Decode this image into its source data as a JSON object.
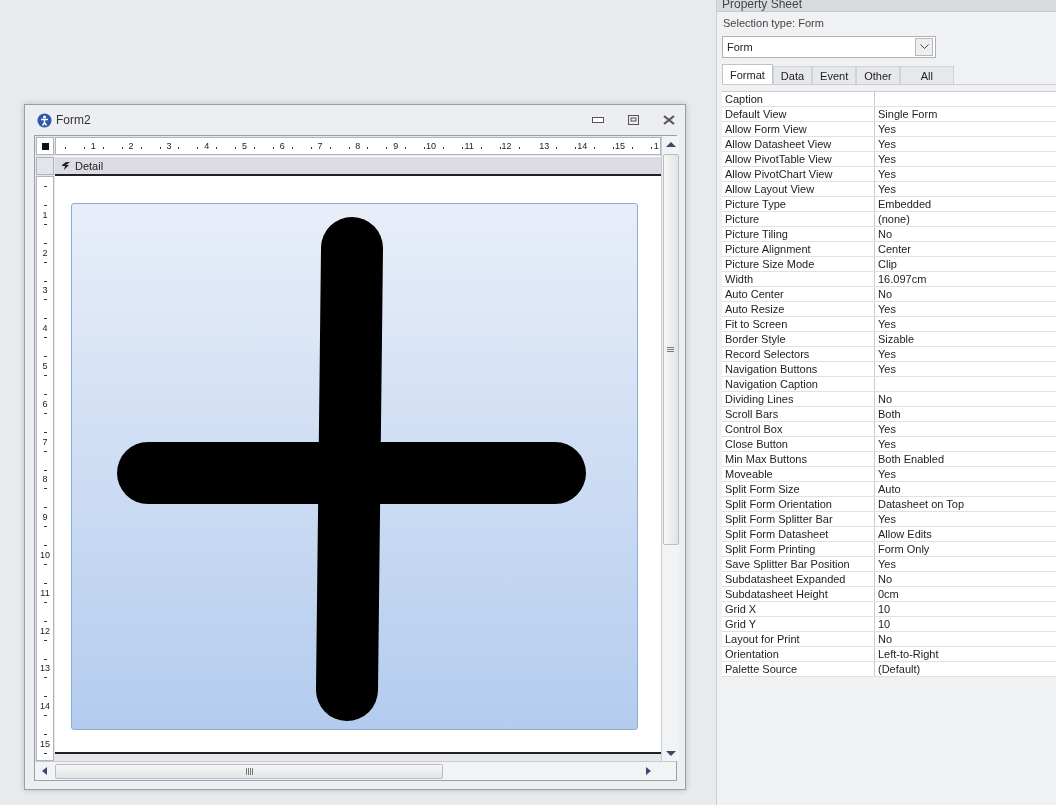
{
  "form_window": {
    "title": "Form2",
    "top_ruler": [
      "1",
      "2",
      "3",
      "4",
      "5",
      "6",
      "7",
      "8",
      "9",
      "10",
      "11",
      "12",
      "13",
      "14",
      "15",
      "1"
    ],
    "left_ruler": [
      "1",
      "2",
      "3",
      "4",
      "5",
      "6",
      "7",
      "8",
      "9",
      "10",
      "11",
      "12",
      "13",
      "14",
      "15"
    ],
    "section": "Detail"
  },
  "property_sheet": {
    "title": "Property Sheet",
    "selection_type": "Selection type:  Form",
    "object_select": "Form",
    "tabs": [
      {
        "label": "Format",
        "selected": true
      },
      {
        "label": "Data",
        "selected": false
      },
      {
        "label": "Event",
        "selected": false
      },
      {
        "label": "Other",
        "selected": false
      },
      {
        "label": "All",
        "selected": false
      }
    ],
    "properties": [
      {
        "name": "Caption"
      },
      {
        "name": "Default View",
        "value": "Single Form"
      },
      {
        "name": "Allow Form View",
        "value": "Yes"
      },
      {
        "name": "Allow Datasheet View",
        "value": "Yes"
      },
      {
        "name": "Allow PivotTable View",
        "value": "Yes"
      },
      {
        "name": "Allow PivotChart View",
        "value": "Yes"
      },
      {
        "name": "Allow Layout View",
        "value": "Yes"
      },
      {
        "name": "Picture Type",
        "value": "Embedded"
      },
      {
        "name": "Picture",
        "value": "(none)"
      },
      {
        "name": "Picture Tiling",
        "value": "No"
      },
      {
        "name": "Picture Alignment",
        "value": "Center"
      },
      {
        "name": "Picture Size Mode",
        "value": "Clip"
      },
      {
        "name": "Width",
        "value": "16.097cm"
      },
      {
        "name": "Auto Center",
        "value": "No"
      },
      {
        "name": "Auto Resize",
        "value": "Yes"
      },
      {
        "name": "Fit to Screen",
        "value": "Yes"
      },
      {
        "name": "Border Style",
        "value": "Sizable"
      },
      {
        "name": "Record Selectors",
        "value": "Yes"
      },
      {
        "name": "Navigation Buttons",
        "value": "Yes"
      },
      {
        "name": "Navigation Caption"
      },
      {
        "name": "Dividing Lines",
        "value": "No"
      },
      {
        "name": "Scroll Bars",
        "value": "Both"
      },
      {
        "name": "Control Box",
        "value": "Yes"
      },
      {
        "name": "Close Button",
        "value": "Yes"
      },
      {
        "name": "Min Max Buttons",
        "value": "Both Enabled"
      },
      {
        "name": "Moveable",
        "value": "Yes"
      },
      {
        "name": "Split Form Size",
        "value": "Auto"
      },
      {
        "name": "Split Form Orientation",
        "value": "Datasheet on Top"
      },
      {
        "name": "Split Form Splitter Bar",
        "value": "Yes"
      },
      {
        "name": "Split Form Datasheet",
        "value": "Allow Edits"
      },
      {
        "name": "Split Form Printing",
        "value": "Form Only"
      },
      {
        "name": "Save Splitter Bar Position",
        "value": "Yes"
      },
      {
        "name": "Subdatasheet Expanded",
        "value": "No"
      },
      {
        "name": "Subdatasheet Height",
        "value": "0cm"
      },
      {
        "name": "Grid X",
        "value": "10"
      },
      {
        "name": "Grid Y",
        "value": "10"
      },
      {
        "name": "Layout for Print",
        "value": "No"
      },
      {
        "name": "Orientation",
        "value": "Left-to-Right"
      },
      {
        "name": "Palette Source",
        "value": "(Default)"
      }
    ]
  }
}
